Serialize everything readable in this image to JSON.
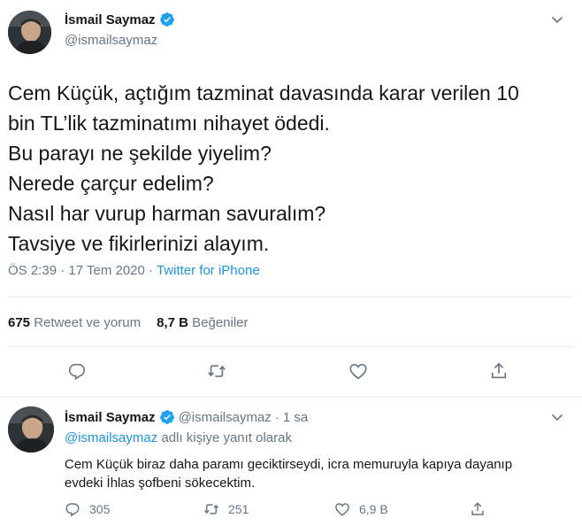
{
  "main_tweet": {
    "author_name": "İsmail Saymaz",
    "author_handle": "@ismailsaymaz",
    "text_lines": [
      "Cem Küçük, açtığım tazminat davasında karar verilen 10",
      "bin TL’lik tazminatımı nihayet ödedi.",
      "Bu parayı ne şekilde yiyelim?",
      "Nerede çarçur edelim?",
      "Nasıl har vurup harman savuralım?",
      "Tavsiye ve fikirlerinizi alayım."
    ],
    "time": "ÖS 2:39",
    "date": "17 Tem 2020",
    "separator": "·",
    "source": "Twitter for iPhone",
    "retweet_count": "675",
    "retweet_label": "Retweet ve yorum",
    "like_count": "8,7 B",
    "like_label": "Beğeniler",
    "actions": [
      "reply-icon",
      "retweet-icon",
      "like-icon",
      "share-icon"
    ]
  },
  "reply_tweet": {
    "author_name": "İsmail Saymaz",
    "author_handle": "@ismailsaymaz",
    "separator": "·",
    "time": "1 sa",
    "reply_to_handle": "@ismailsaymaz",
    "reply_to_suffix": "adlı kişiye yanıt olarak",
    "text_lines": [
      "Cem Küçük biraz daha paramı geciktirseydi, icra memuruyla kapıya dayanıp",
      "evdeki İhlas şofbeni sökecektim."
    ],
    "reply_count": "305",
    "retweet_count": "251",
    "like_count": "6,9 B"
  },
  "colors": {
    "text": "#14171a",
    "secondary": "#657786",
    "link": "#1b95e0",
    "verified": "#1da1f2",
    "divider": "#e6ecf0"
  }
}
